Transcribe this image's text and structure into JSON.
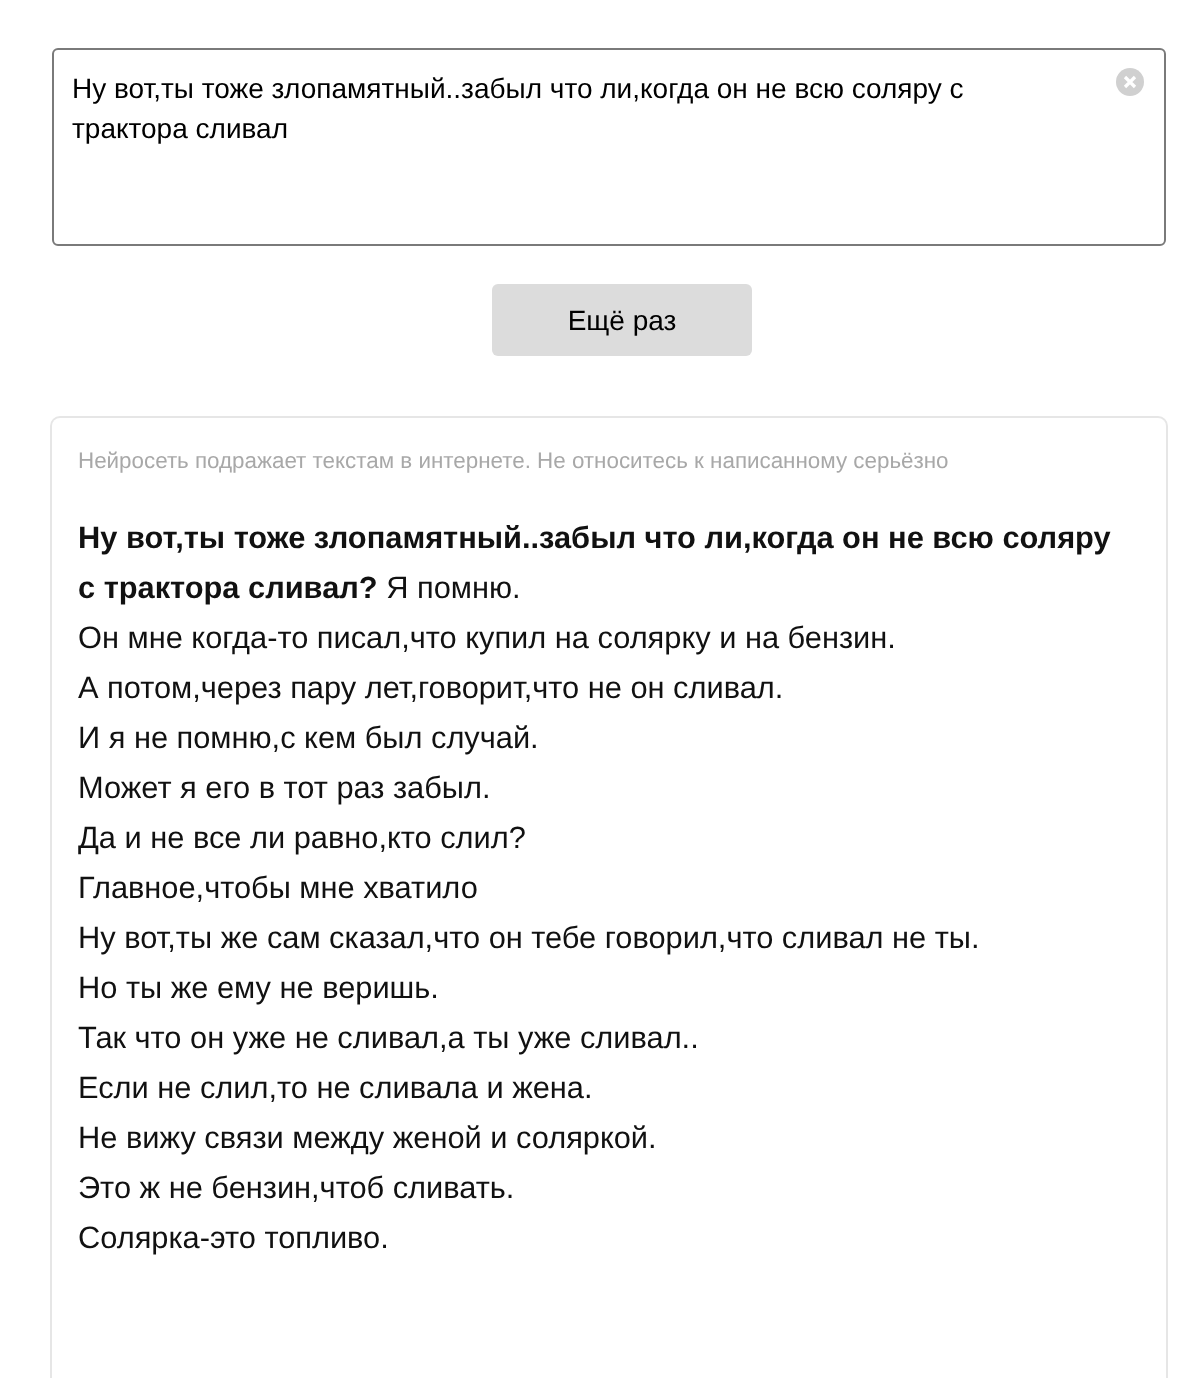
{
  "prompt_field": {
    "value": "Ну вот,ты тоже злопамятный..забыл что ли,когда он не всю соляру с трактора сливал"
  },
  "retry_button": {
    "label": "Ещё раз"
  },
  "result": {
    "disclaimer": "Нейросеть подражает текстам в интернете. Не относитесь к написанному серьёзно",
    "lines": [
      "**Ну вот,ты тоже злопамятный..забыл что ли,когда он не всю соляру с трактора сливал?** Я помню.",
      "Он мне когда-то писал,что купил на солярку и на бензин.",
      "А потом,через пару лет,говорит,что не он сливал.",
      "И я не помню,с кем был случай.",
      "Может я его в тот раз забыл.",
      "Да и не все ли равно,кто слил?",
      "Главное,чтобы мне хватило",
      "Ну вот,ты же сам сказал,что он тебе говорил,что сливал не ты.",
      "Но ты же ему не веришь.",
      "Так что он уже не сливал,а ты уже сливал..",
      "Если не слил,то не сливала и жена.",
      "Не вижу связи между женой и соляркой.",
      "Это ж не бензин,чтоб сливать.",
      "Солярка-это топливо."
    ]
  }
}
